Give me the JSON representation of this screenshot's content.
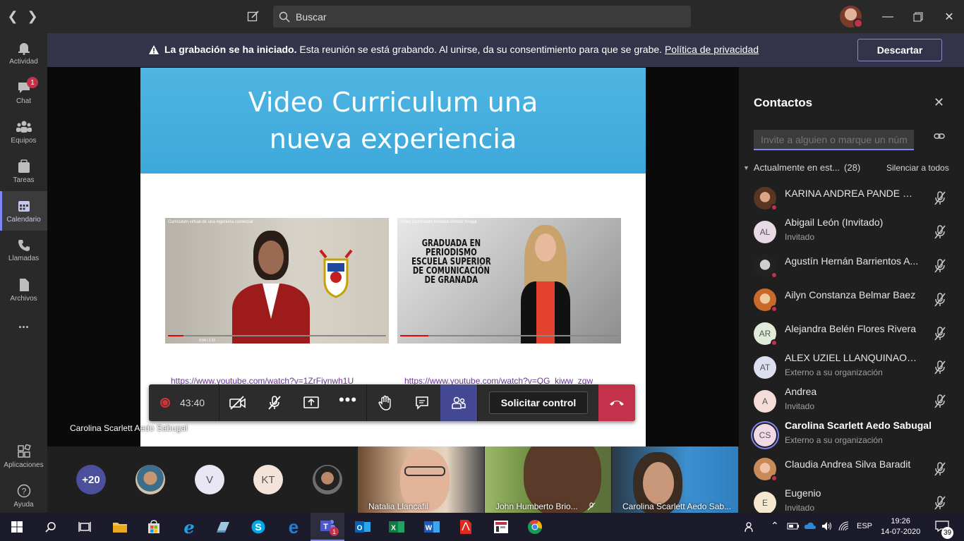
{
  "search": {
    "placeholder": "Buscar"
  },
  "rail": {
    "items": [
      {
        "label": "Actividad",
        "icon": "bell-icon"
      },
      {
        "label": "Chat",
        "icon": "chat-icon",
        "badge": "1"
      },
      {
        "label": "Equipos",
        "icon": "teams-icon"
      },
      {
        "label": "Tareas",
        "icon": "tasks-icon"
      },
      {
        "label": "Calendario",
        "icon": "calendar-icon"
      },
      {
        "label": "Llamadas",
        "icon": "phone-icon"
      },
      {
        "label": "Archivos",
        "icon": "files-icon"
      }
    ],
    "more": "...",
    "apps": "Aplicaciones",
    "help": "Ayuda"
  },
  "banner": {
    "bold": "La grabación se ha iniciado.",
    "text": " Esta reunión se está grabando. Al unirse, da su consentimiento para que se grabe. ",
    "link": "Política de privacidad",
    "dismiss": "Descartar"
  },
  "slide": {
    "title": "Video Curriculum una nueva experiencia",
    "video1_title": "Curriculum virtual de una ingeniera comercial",
    "video1_time": "0:04 / 1:11",
    "video1_progress": 0.07,
    "video2_title": "Video Curriculum Amaelia Gómez Anaya",
    "video2_text": "GRADUADA EN PERIODISMO ESCUELA SUPERIOR DE COMUNICACIÓN DE GRANADA",
    "video2_progress": 0.13,
    "link1": "https://www.youtube.com/watch?v=1ZrFiynwh1U",
    "link2": "https://www.youtube.com/watch?v=QG_kiww_zgw"
  },
  "speaker": "Carolina Scarlett Aedo Sabugal",
  "callbar": {
    "timer": "43:40",
    "request_control": "Solicitar control"
  },
  "strip": {
    "more": "+20",
    "initials": [
      "V",
      "KT"
    ],
    "tiles": [
      "Natalia Llancafil",
      "John Humberto Brio...",
      "Carolina Scarlett Aedo Sab..."
    ]
  },
  "panel": {
    "title": "Contactos",
    "invite_placeholder": "Invite a alguien o marque un núm",
    "section": "Actualmente en est...",
    "count": "(28)",
    "mute_all": "Silenciar a todos",
    "people": [
      {
        "name": "KARINA ANDREA PANDE CA...",
        "sub": "",
        "initials": "",
        "photo": true
      },
      {
        "name": "Abigail León (Invitado)",
        "sub": "Invitado",
        "initials": "AL"
      },
      {
        "name": "Agustín Hernán Barrientos A...",
        "sub": "",
        "initials": "",
        "photo": true
      },
      {
        "name": "Ailyn Constanza Belmar Baez",
        "sub": "",
        "initials": "",
        "photo": true
      },
      {
        "name": "Alejandra Belén Flores Rivera",
        "sub": "",
        "initials": "AR"
      },
      {
        "name": "ALEX UZIEL LLANQUINAO T...",
        "sub": "Externo a su organización",
        "initials": "AT"
      },
      {
        "name": "Andrea",
        "sub": "Invitado",
        "initials": "A"
      },
      {
        "name": "Carolina Scarlett Aedo Sabugal",
        "sub": "Externo a su organización",
        "initials": "CS"
      },
      {
        "name": "Claudia Andrea Silva Baradit",
        "sub": "",
        "initials": "",
        "photo": true
      },
      {
        "name": "Eugenio",
        "sub": "Invitado",
        "initials": "E"
      }
    ]
  },
  "taskbar": {
    "lang": "ESP",
    "time": "19:26",
    "date": "14-07-2020",
    "notif": "39",
    "teams_badge": "1"
  },
  "colors": {
    "accent": "#7f85f5",
    "hangup": "#c4314b",
    "banner": "#33344a",
    "slide_header": "#3ca8da"
  }
}
